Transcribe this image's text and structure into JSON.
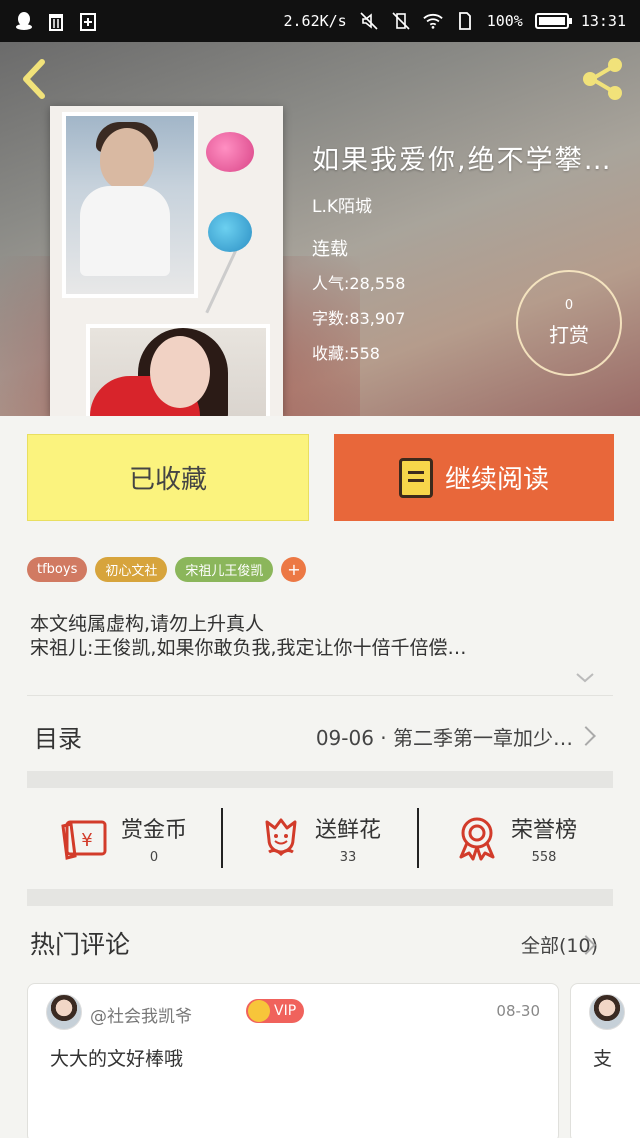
{
  "status_bar": {
    "speed": "2.62K/s",
    "battery": "100%",
    "battery_fraction": 1.0,
    "time": "13:31",
    "icons": [
      "qq-icon",
      "trash-icon",
      "battery-saver-icon",
      "mute-icon",
      "vibrate-icon",
      "wifi-icon",
      "sim-icon"
    ]
  },
  "book": {
    "title": "如果我爱你,绝不学攀…",
    "author": "L.K陌城",
    "status": "连载",
    "popularity": "人气:28,558",
    "word_count": "字数:83,907",
    "favorites": "收藏:558"
  },
  "reward": {
    "count": "0",
    "label": "打赏"
  },
  "buttons": {
    "favorited": "已收藏",
    "continue_reading": "继续阅读"
  },
  "tags": [
    "tfboys",
    "初心文社",
    "宋祖儿王俊凯"
  ],
  "tag_add": "+",
  "description": {
    "line1": "本文纯属虚构,请勿上升真人",
    "line2": "宋祖儿:王俊凯,如果你敢负我,我定让你十倍千倍偿…"
  },
  "toc": {
    "label": "目录",
    "latest": "09-06 · 第二季第一章加少…"
  },
  "actions": [
    {
      "label": "赏金币",
      "count": "0"
    },
    {
      "label": "送鲜花",
      "count": "33"
    },
    {
      "label": "荣誉榜",
      "count": "558"
    }
  ],
  "comments_section": {
    "title": "热门评论",
    "all_label": "全部(10)"
  },
  "comments": [
    {
      "user": "@社会我凯爷",
      "badge": "VIP",
      "date": "08-30",
      "text": "大大的文好棒哦"
    },
    {
      "text": "支"
    }
  ],
  "colors": {
    "accent_orange": "#e8673a",
    "fav_yellow": "#fbf37e",
    "vip_red": "#f0625c"
  }
}
